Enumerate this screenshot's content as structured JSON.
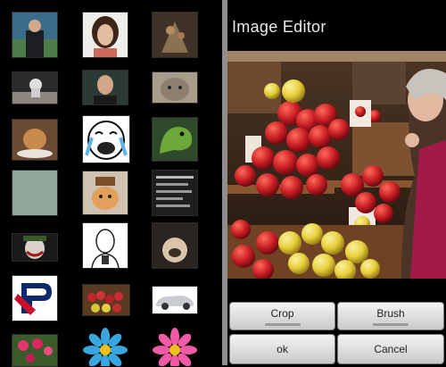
{
  "gallery": {
    "thumbnails": [
      {
        "name": "man-in-coat",
        "row": 1,
        "col": 1
      },
      {
        "name": "woman-portrait",
        "row": 1,
        "col": 2
      },
      {
        "name": "dried-flowers",
        "row": 1,
        "col": 3
      },
      {
        "name": "astronaut",
        "row": 2,
        "col": 1
      },
      {
        "name": "man-portrait",
        "row": 2,
        "col": 2
      },
      {
        "name": "cat-face",
        "row": 2,
        "col": 3
      },
      {
        "name": "cat-with-plate",
        "row": 3,
        "col": 1
      },
      {
        "name": "crying-cartoon",
        "row": 3,
        "col": 2
      },
      {
        "name": "green-dinosaur",
        "row": 3,
        "col": 3
      },
      {
        "name": "blank-sage",
        "row": 4,
        "col": 1
      },
      {
        "name": "cat-with-hat",
        "row": 4,
        "col": 2
      },
      {
        "name": "text-card",
        "row": 4,
        "col": 3
      },
      {
        "name": "joker-face",
        "row": 5,
        "col": 1
      },
      {
        "name": "sketch-portrait",
        "row": 5,
        "col": 2
      },
      {
        "name": "pug-dog",
        "row": 5,
        "col": 3
      },
      {
        "name": "penn-logo",
        "row": 6,
        "col": 1
      },
      {
        "name": "fruit-market",
        "row": 6,
        "col": 2
      },
      {
        "name": "silver-car",
        "row": 6,
        "col": 3
      },
      {
        "name": "pink-flowers",
        "row": 7,
        "col": 1
      },
      {
        "name": "blue-daisy",
        "row": 7,
        "col": 2
      },
      {
        "name": "pink-daisy",
        "row": 7,
        "col": 3
      }
    ]
  },
  "editor": {
    "title": "Image Editor",
    "buttons": {
      "crop": "Crop",
      "brush": "Brush",
      "ok": "ok",
      "cancel": "Cancel"
    }
  },
  "colors": {
    "background": "#000000",
    "divider": "#8d8d8d",
    "button_top": "#f4f4f4",
    "button_bottom": "#c9c9c9",
    "title_text": "#e8e8e8"
  }
}
